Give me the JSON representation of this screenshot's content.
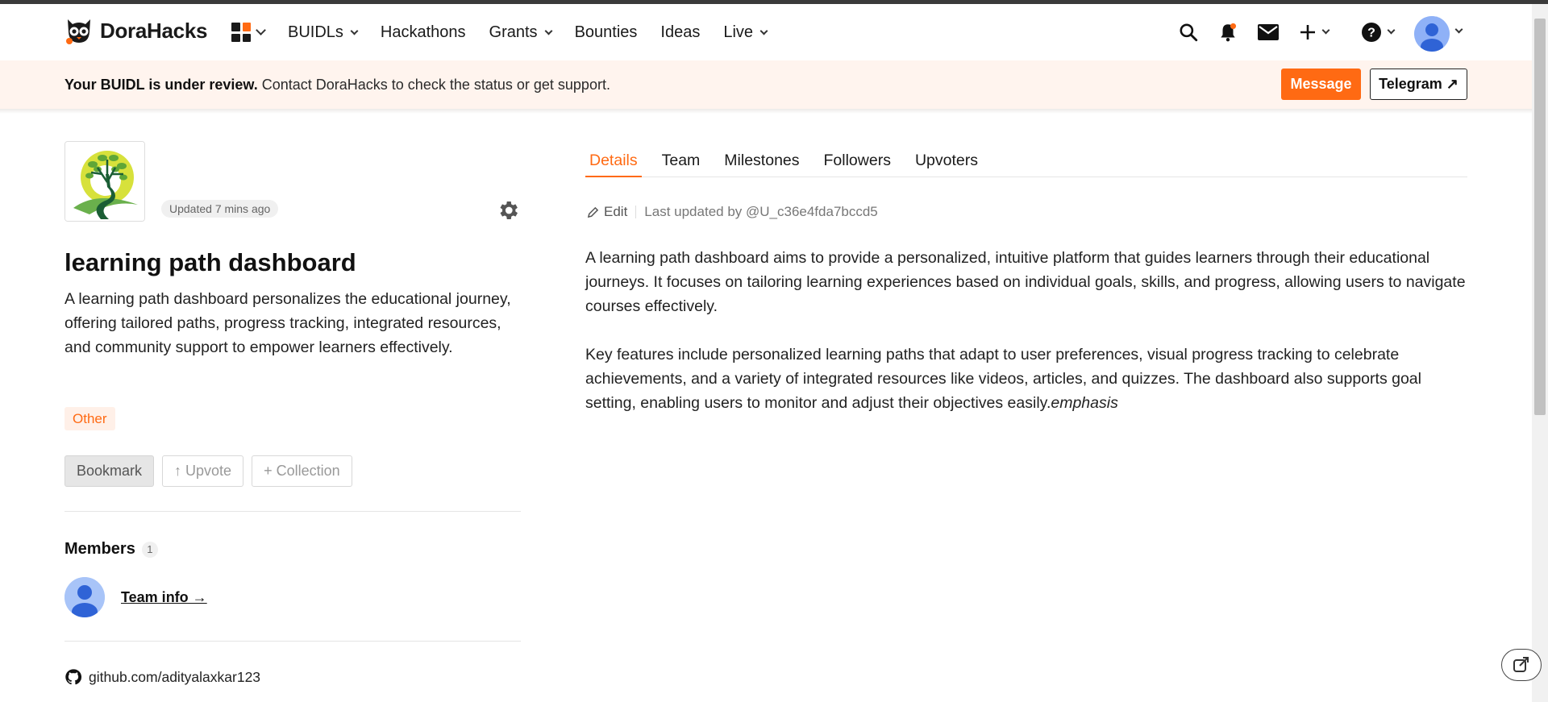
{
  "nav": {
    "brand": "DoraHacks",
    "menu": [
      {
        "label": "BUIDLs",
        "dropdown": true
      },
      {
        "label": "Hackathons",
        "dropdown": false
      },
      {
        "label": "Grants",
        "dropdown": true
      },
      {
        "label": "Bounties",
        "dropdown": false
      },
      {
        "label": "Ideas",
        "dropdown": false
      },
      {
        "label": "Live",
        "dropdown": true
      }
    ],
    "icons": [
      "apps-grid-icon",
      "search-icon",
      "bell-icon",
      "mail-icon",
      "plus-icon",
      "help-icon",
      "user-avatar"
    ],
    "notification_dot_color": "#ff6a13"
  },
  "banner": {
    "strong": "Your BUIDL is under review.",
    "text": " Contact DoraHacks to check the status or get support.",
    "message_label": "Message",
    "telegram_label": "Telegram ↗"
  },
  "project": {
    "updated": "Updated 7 mins ago",
    "title": "learning path dashboard",
    "summary": "A learning path dashboard personalizes the educational journey, offering tailored paths, progress tracking, integrated resources, and community support to empower learners effectively.",
    "tag": "Other",
    "actions": {
      "bookmark": "Bookmark",
      "upvote": "↑ Upvote",
      "collection": "+ Collection"
    }
  },
  "members": {
    "title": "Members",
    "count": "1",
    "team_link": "Team info →"
  },
  "github": {
    "label": "github.com/adityalaxkar123"
  },
  "tabs": [
    "Details",
    "Team",
    "Milestones",
    "Followers",
    "Upvoters"
  ],
  "details": {
    "edit_label": "Edit",
    "last_updated": "Last updated by @U_c36e4fda7bccd5",
    "paragraph1": "A learning path dashboard aims to provide a personalized, intuitive platform that guides learners through their educational journeys. It focuses on tailoring learning experiences based on individual goals, skills, and progress, allowing users to navigate courses effectively.",
    "paragraph2": "Key features include personalized learning paths that adapt to user preferences, visual progress tracking to celebrate achievements, and a variety of integrated resources like videos, articles, and quizzes. The dashboard also supports goal setting, enabling users to monitor and adjust their objectives easily.",
    "emphasis": "emphasis"
  },
  "colors": {
    "accent": "#ff6a13",
    "banner_bg": "#fff4ee"
  }
}
